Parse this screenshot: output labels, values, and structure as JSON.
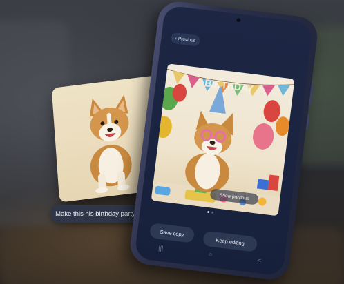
{
  "prompt_text": "Make this his birthday party",
  "phone": {
    "back_icon": "chevron-left-icon",
    "previous_label": "Previous",
    "banner_text": "BIRTHDAY",
    "show_previous_label": "Show previous",
    "save_copy_label": "Save copy",
    "keep_editing_label": "Keep editing",
    "nav_icons": [
      "recents-icon",
      "home-icon",
      "back-icon"
    ],
    "nav_glyphs": [
      "|||",
      "○",
      "<"
    ],
    "pager_dots": 2
  },
  "colors": {
    "phone_frame": "#2b2f49",
    "screen_bg": "#1d2744",
    "pill_bg": "#2d3853",
    "prompt_bg": "#2e3648",
    "card_bg": "#efe3c6"
  }
}
